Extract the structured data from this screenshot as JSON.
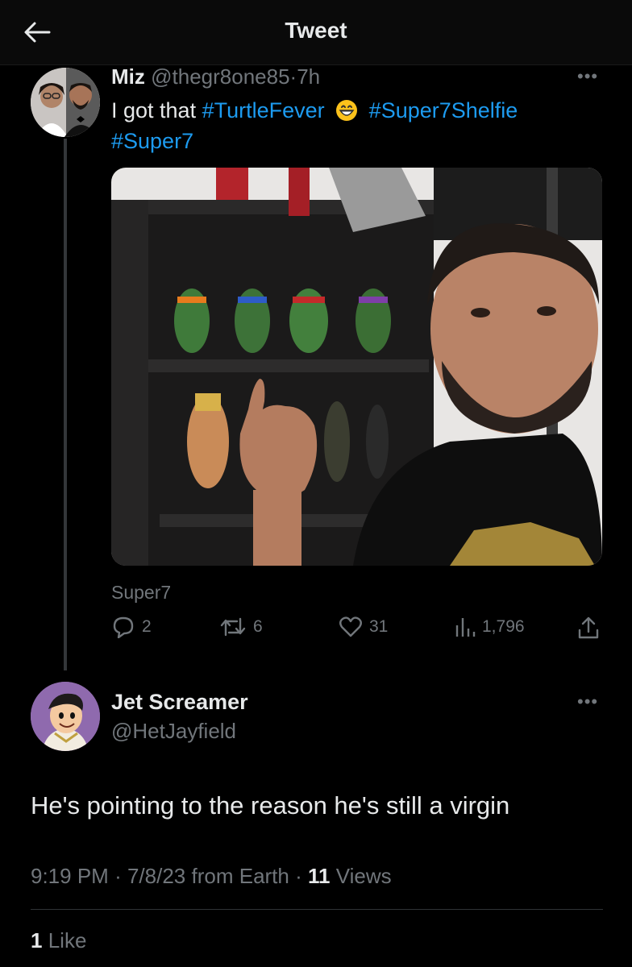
{
  "header": {
    "title": "Tweet"
  },
  "original_tweet": {
    "author_name": "Miz",
    "handle": "@thegr8one85",
    "separator": "·",
    "time": "7h",
    "text_prefix": "I got that",
    "hashtags": [
      "#TurtleFever",
      "#Super7Shelfie",
      "#Super7"
    ],
    "media_caption": "Super7",
    "stats": {
      "replies": "2",
      "retweets": "6",
      "likes": "31",
      "views": "1,796"
    }
  },
  "reply_tweet": {
    "author_name": "Jet Screamer",
    "handle": "@HetJayfield",
    "text": "He's pointing to the reason he's still a virgin",
    "time": "9:19 PM",
    "date": "7/8/23",
    "source": "from Earth",
    "separator": "·",
    "views_count": "11",
    "views_label": "Views",
    "likes_count": "1",
    "likes_label": "Like"
  },
  "colors": {
    "background": "#000000",
    "text": "#e7e9ea",
    "muted": "#71767b",
    "link": "#1d9bf0",
    "divider": "#2f3336"
  }
}
